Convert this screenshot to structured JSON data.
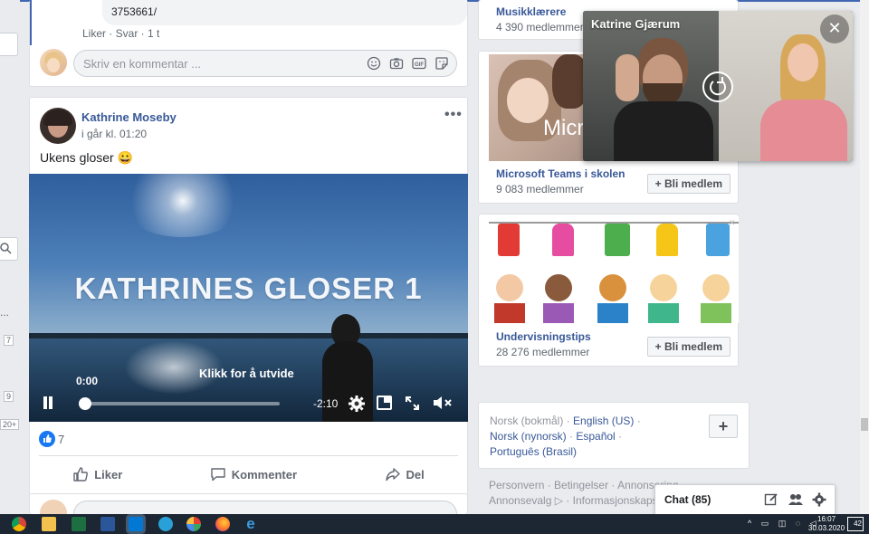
{
  "prev_post": {
    "comment_tail": "3753661/",
    "comment_actions": "Liker · Svar · 1 t",
    "comment_placeholder": "Skriv en kommentar ..."
  },
  "post": {
    "author": "Kathrine Moseby",
    "time": "i går kl. 01:20",
    "text": "Ukens gloser 😀",
    "video": {
      "title": "KATHRINES GLOSER 1",
      "current_time": "0:00",
      "expand_hint": "Klikk for å utvide",
      "remaining": "-2:10",
      "progress": 0
    },
    "reactions_count": "7",
    "actions": {
      "like": "Liker",
      "comment": "Kommenter",
      "share": "Del"
    }
  },
  "sidebar": {
    "groups": [
      {
        "name": "Musikklærere",
        "members": "4 390 medlemmer"
      },
      {
        "name": "Microsoft Teams i skolen",
        "members": "9 083 medlemmer",
        "join": "+ Bli medlem",
        "image_text": "Micro"
      },
      {
        "name": "Undervisningstips",
        "members": "28 276 medlemmer",
        "join": "+ Bli medlem"
      }
    ],
    "languages": {
      "items": [
        "Norsk (bokmål)",
        "English (US)",
        "Norsk (nynorsk)",
        "Español",
        "Português (Brasil)"
      ],
      "add_label": "+"
    },
    "footer": [
      "Personvern",
      "Betingelser",
      "Annonsering",
      "Annonsevalg",
      "Informasjonskapsler"
    ]
  },
  "video_call": {
    "caller": "Katrine Gjærum",
    "close": "✕"
  },
  "chat": {
    "label": "Chat (85)"
  },
  "left_rail": {
    "num1": "7",
    "num2": "9",
    "num3": "20+",
    "dots": "..."
  },
  "taskbar": {
    "time": "16:07",
    "date": "30.03.2020",
    "notif": "42"
  },
  "colors": {
    "fb_blue": "#385898",
    "brand": "#4267b2",
    "like_blue": "#1877f2"
  }
}
